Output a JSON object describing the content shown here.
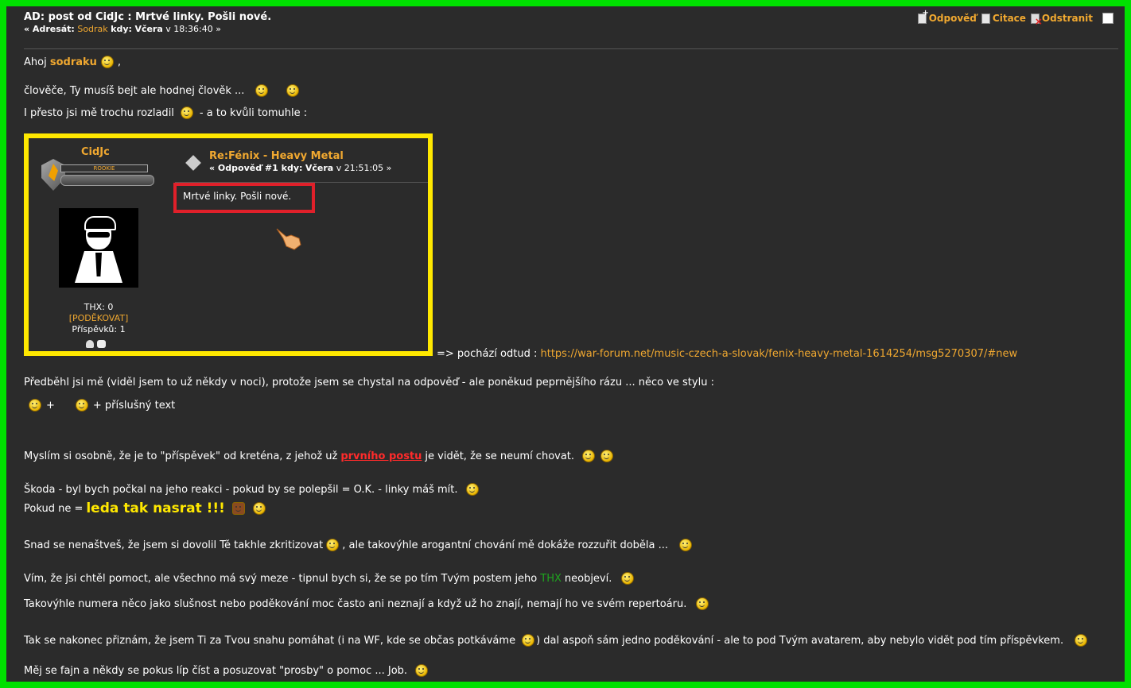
{
  "header": {
    "title": "AD: post od CidJc : Mrtvé linky. Pošli nové.",
    "prefix": "« Adresát:",
    "recipient": "Sodrak",
    "when_label": "kdy:",
    "when_day": "Včera",
    "when_time": "v 18:36:40 »"
  },
  "actions": {
    "reply": "Odpověď",
    "quote": "Citace",
    "delete": "Odstranit"
  },
  "body": {
    "greet_pre": "Ahoj",
    "greet_name": "sodraku",
    "greet_post": ",",
    "l2": "člověče, Ty musíš bejt ale hodnej člověk ...",
    "l3a": "I přesto jsi mě trochu rozladil",
    "l3b": "- a to kvůli tomuhle :",
    "after_quote": "=> pochází odtud :",
    "url": "https://war-forum.net/music-czech-a-slovak/fenix-heavy-metal-1614254/msg5270307/#new",
    "l5": "Předběhl jsi mě (viděl jsem to už někdy v noci), protože jsem se chystal na odpověď - ale poněkud peprnějšího rázu ... něco ve stylu :",
    "l6a": "+",
    "l6b": "+ příslušný text",
    "l7a": "Myslím si osobně, že je to \"příspěvek\" od kreténa, z jehož už",
    "l7link": "prvního postu",
    "l7b": "je vidět, že se neumí chovat.",
    "l8": "Škoda - byl bych počkal na jeho reakci - pokud by se polepšil = O.K. - linky máš mít.",
    "l9a": "Pokud ne =",
    "l9big": "leda tak nasrat !!!",
    "l10a": "Snad se nenaštveš, že jsem si dovolil Tě takhle zkritizovat",
    "l10b": ", ale takovýhle arogantní chování mě dokáže rozzuřit doběla ...",
    "l11a": "Vím, že jsi chtěl pomoct, ale všechno má svý meze - tipnul bych si, že se po tím Tvým postem jeho",
    "l11thx": "THX",
    "l11b": "neobjeví.",
    "l12": "Takovýhle numera něco jako slušnost nebo poděkování moc často ani neznají a když už ho znají, nemají ho ve svém repertoáru.",
    "l13a": "Tak se nakonec přiznám, že jsem Ti za Tvou snahu pomáhat (i na WF, kde se občas potkáváme",
    "l13b": ") dal aspoň sám jedno poděkování - ale to pod Tvým avatarem, aby nebylo vidět pod tím příspěvkem.",
    "l14": "Měj se fajn a někdy se pokus líp číst a posuzovat \"prosby\" o pomoc ... Job."
  },
  "quote": {
    "username": "CidJc",
    "rank": "ROOKIE",
    "subject": "Re:Fénix - Heavy Metal",
    "meta_prefix": "« Odpověď #1 kdy:",
    "meta_day": "Včera",
    "meta_time": "v 21:51:05 »",
    "body": "Mrtvé linky. Pošli nové.",
    "thx": "THX: 0",
    "thank": "[PODĚKOVAT]",
    "posts": "Příspěvků: 1"
  },
  "colors": {
    "accent": "#f0a830",
    "frame": "#00e000",
    "highlight": "#ffe800",
    "marker": "#e0202a"
  }
}
